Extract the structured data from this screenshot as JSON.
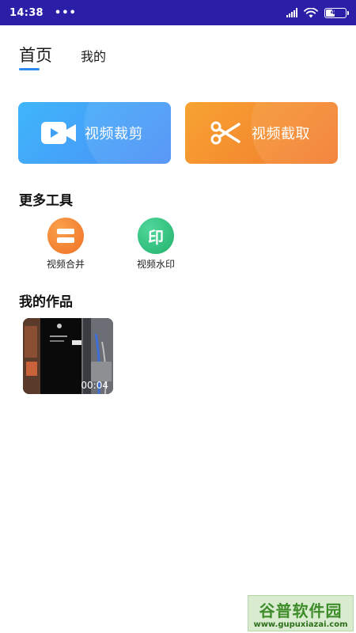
{
  "status_bar": {
    "time": "14:38",
    "dots": "•••",
    "battery": "47"
  },
  "tabs": [
    {
      "label": "首页",
      "active": true
    },
    {
      "label": "我的",
      "active": false
    }
  ],
  "cards": [
    {
      "label": "视频裁剪",
      "icon": "video-camera-icon",
      "color": "#4a8ef6"
    },
    {
      "label": "视频截取",
      "icon": "scissors-icon",
      "color": "#f27a2e"
    }
  ],
  "more_tools": {
    "title": "更多工具",
    "items": [
      {
        "label": "视频合并",
        "icon": "merge-icon",
        "color": "#f27a2e"
      },
      {
        "label": "视频水印",
        "icon": "watermark-icon",
        "color": "#2bbf7a",
        "icon_text": "印"
      }
    ]
  },
  "works": {
    "title": "我的作品",
    "items": [
      {
        "duration": "00:04"
      }
    ]
  },
  "watermark": {
    "title": "谷普软件园",
    "url": "www.gupuxiazai.com"
  }
}
